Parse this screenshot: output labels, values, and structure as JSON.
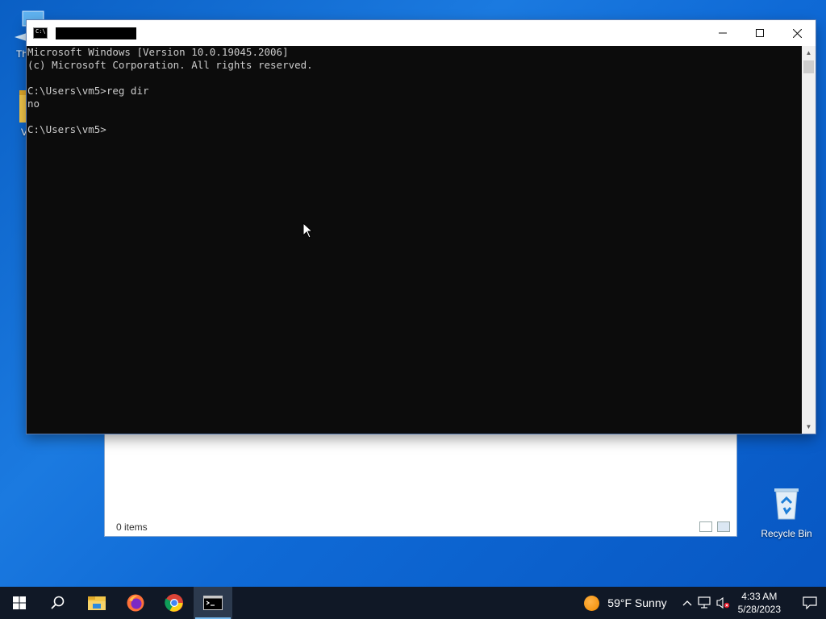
{
  "desktop": {
    "pc_label": "Th",
    "folder_label": "V",
    "recycle_label": "Recycle Bin"
  },
  "explorer": {
    "status": "0 items"
  },
  "cmd": {
    "console_lines": [
      "Microsoft Windows [Version 10.0.19045.2006]",
      "(c) Microsoft Corporation. All rights reserved.",
      "",
      "C:\\Users\\vm5>reg dir",
      "no",
      "",
      "C:\\Users\\vm5>"
    ],
    "icon_text": "C:\\"
  },
  "taskbar": {
    "weather": "59°F  Sunny",
    "time": "4:33 AM",
    "date": "5/28/2023",
    "apps": [
      "start-icon",
      "search-icon",
      "file-explorer-icon",
      "firefox-icon",
      "chrome-icon",
      "cmd-icon"
    ]
  },
  "colors": {
    "desktop": "#0f6ad6",
    "console_bg": "#0c0c0c",
    "console_text": "#cccccc",
    "taskbar": "#101826"
  }
}
